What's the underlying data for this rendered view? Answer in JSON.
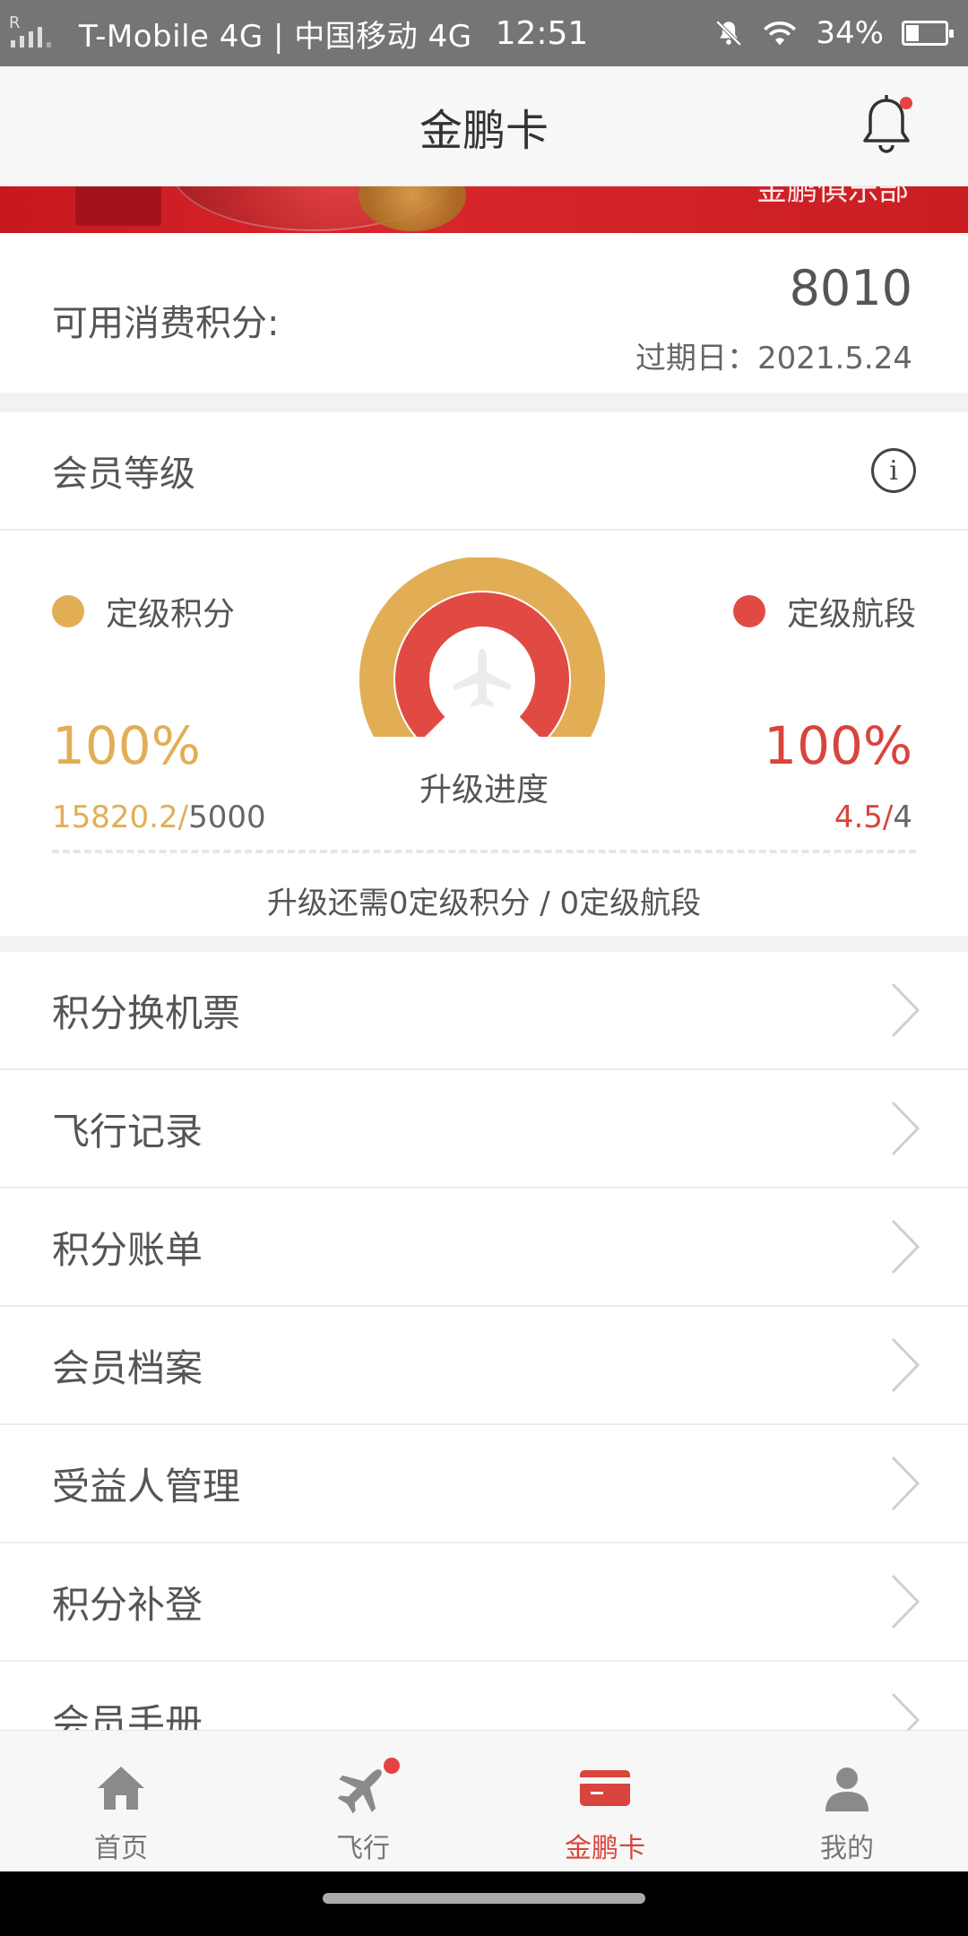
{
  "status_bar": {
    "carrier": "T-Mobile 4G | 中国移动 4G",
    "time": "12:51",
    "battery": "34%"
  },
  "header": {
    "title": "金鹏卡"
  },
  "banner": {
    "club_text": "金鹏俱乐部"
  },
  "points": {
    "label": "可用消费积分:",
    "value": "8010",
    "expiry": "过期日：2021.5.24"
  },
  "level": {
    "title": "会员等级",
    "legend_points": "定级积分",
    "legend_segments": "定级航段",
    "points_percent": "100%",
    "segments_percent": "100%",
    "points_current": "15820.2/",
    "points_total": "5000",
    "segments_current": "4.5/",
    "segments_total": "4",
    "progress_caption": "升级进度",
    "upgrade_note": "升级还需0定级积分 / 0定级航段",
    "points_progress": 1.0,
    "segments_progress": 1.0
  },
  "menu": {
    "items": [
      {
        "label": "积分换机票"
      },
      {
        "label": "飞行记录"
      },
      {
        "label": "积分账单"
      },
      {
        "label": "会员档案"
      },
      {
        "label": "受益人管理"
      },
      {
        "label": "积分补登"
      },
      {
        "label": "会员手册"
      }
    ]
  },
  "bottom_nav": {
    "items": [
      {
        "label": "首页",
        "icon": "home-icon"
      },
      {
        "label": "飞行",
        "icon": "plane-icon"
      },
      {
        "label": "金鹏卡",
        "icon": "card-icon"
      },
      {
        "label": "我的",
        "icon": "user-icon"
      }
    ],
    "active": 2
  },
  "colors": {
    "gold": "#e2ae55",
    "red": "#d9443c",
    "banner_red": "#c8181f"
  }
}
